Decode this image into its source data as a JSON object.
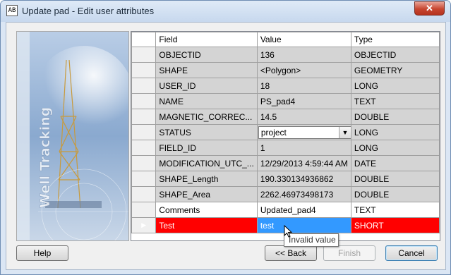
{
  "window": {
    "title": "Update pad - Edit user attributes",
    "icon_text": "AB",
    "close_symbol": "✕"
  },
  "banner": {
    "text": "Well Tracking"
  },
  "grid": {
    "columns": [
      "Field",
      "Value",
      "Type"
    ],
    "rows": [
      {
        "field": "OBJECTID",
        "value": "136",
        "type": "OBJECTID"
      },
      {
        "field": "SHAPE",
        "value": "<Polygon>",
        "type": "GEOMETRY"
      },
      {
        "field": "USER_ID",
        "value": "18",
        "type": "LONG"
      },
      {
        "field": "NAME",
        "value": "PS_pad4",
        "type": "TEXT"
      },
      {
        "field": "MAGNETIC_CORREC...",
        "value": "14.5",
        "type": "DOUBLE"
      },
      {
        "field": "STATUS",
        "value": "project",
        "type": "LONG"
      },
      {
        "field": "FIELD_ID",
        "value": "1",
        "type": "LONG"
      },
      {
        "field": "MODIFICATION_UTC_...",
        "value": "12/29/2013 4:59:44 AM",
        "type": "DATE"
      },
      {
        "field": "SHAPE_Length",
        "value": "190.330134936862",
        "type": "DOUBLE"
      },
      {
        "field": "SHAPE_Area",
        "value": "2262.46973498173",
        "type": "DOUBLE"
      },
      {
        "field": "Comments",
        "value": "Updated_pad4",
        "type": "TEXT"
      },
      {
        "field": "Test",
        "value": "test",
        "type": "SHORT"
      }
    ],
    "current_row_marker": "▶",
    "combo_arrow": "▼"
  },
  "tooltip": {
    "text": "Invalid value"
  },
  "buttons": {
    "help": "Help",
    "back": "<< Back",
    "finish": "Finish",
    "cancel": "Cancel"
  },
  "colors": {
    "error_row": "#ff0000",
    "edit_cell": "#3399ff",
    "readonly_row": "#d4d4d4"
  }
}
